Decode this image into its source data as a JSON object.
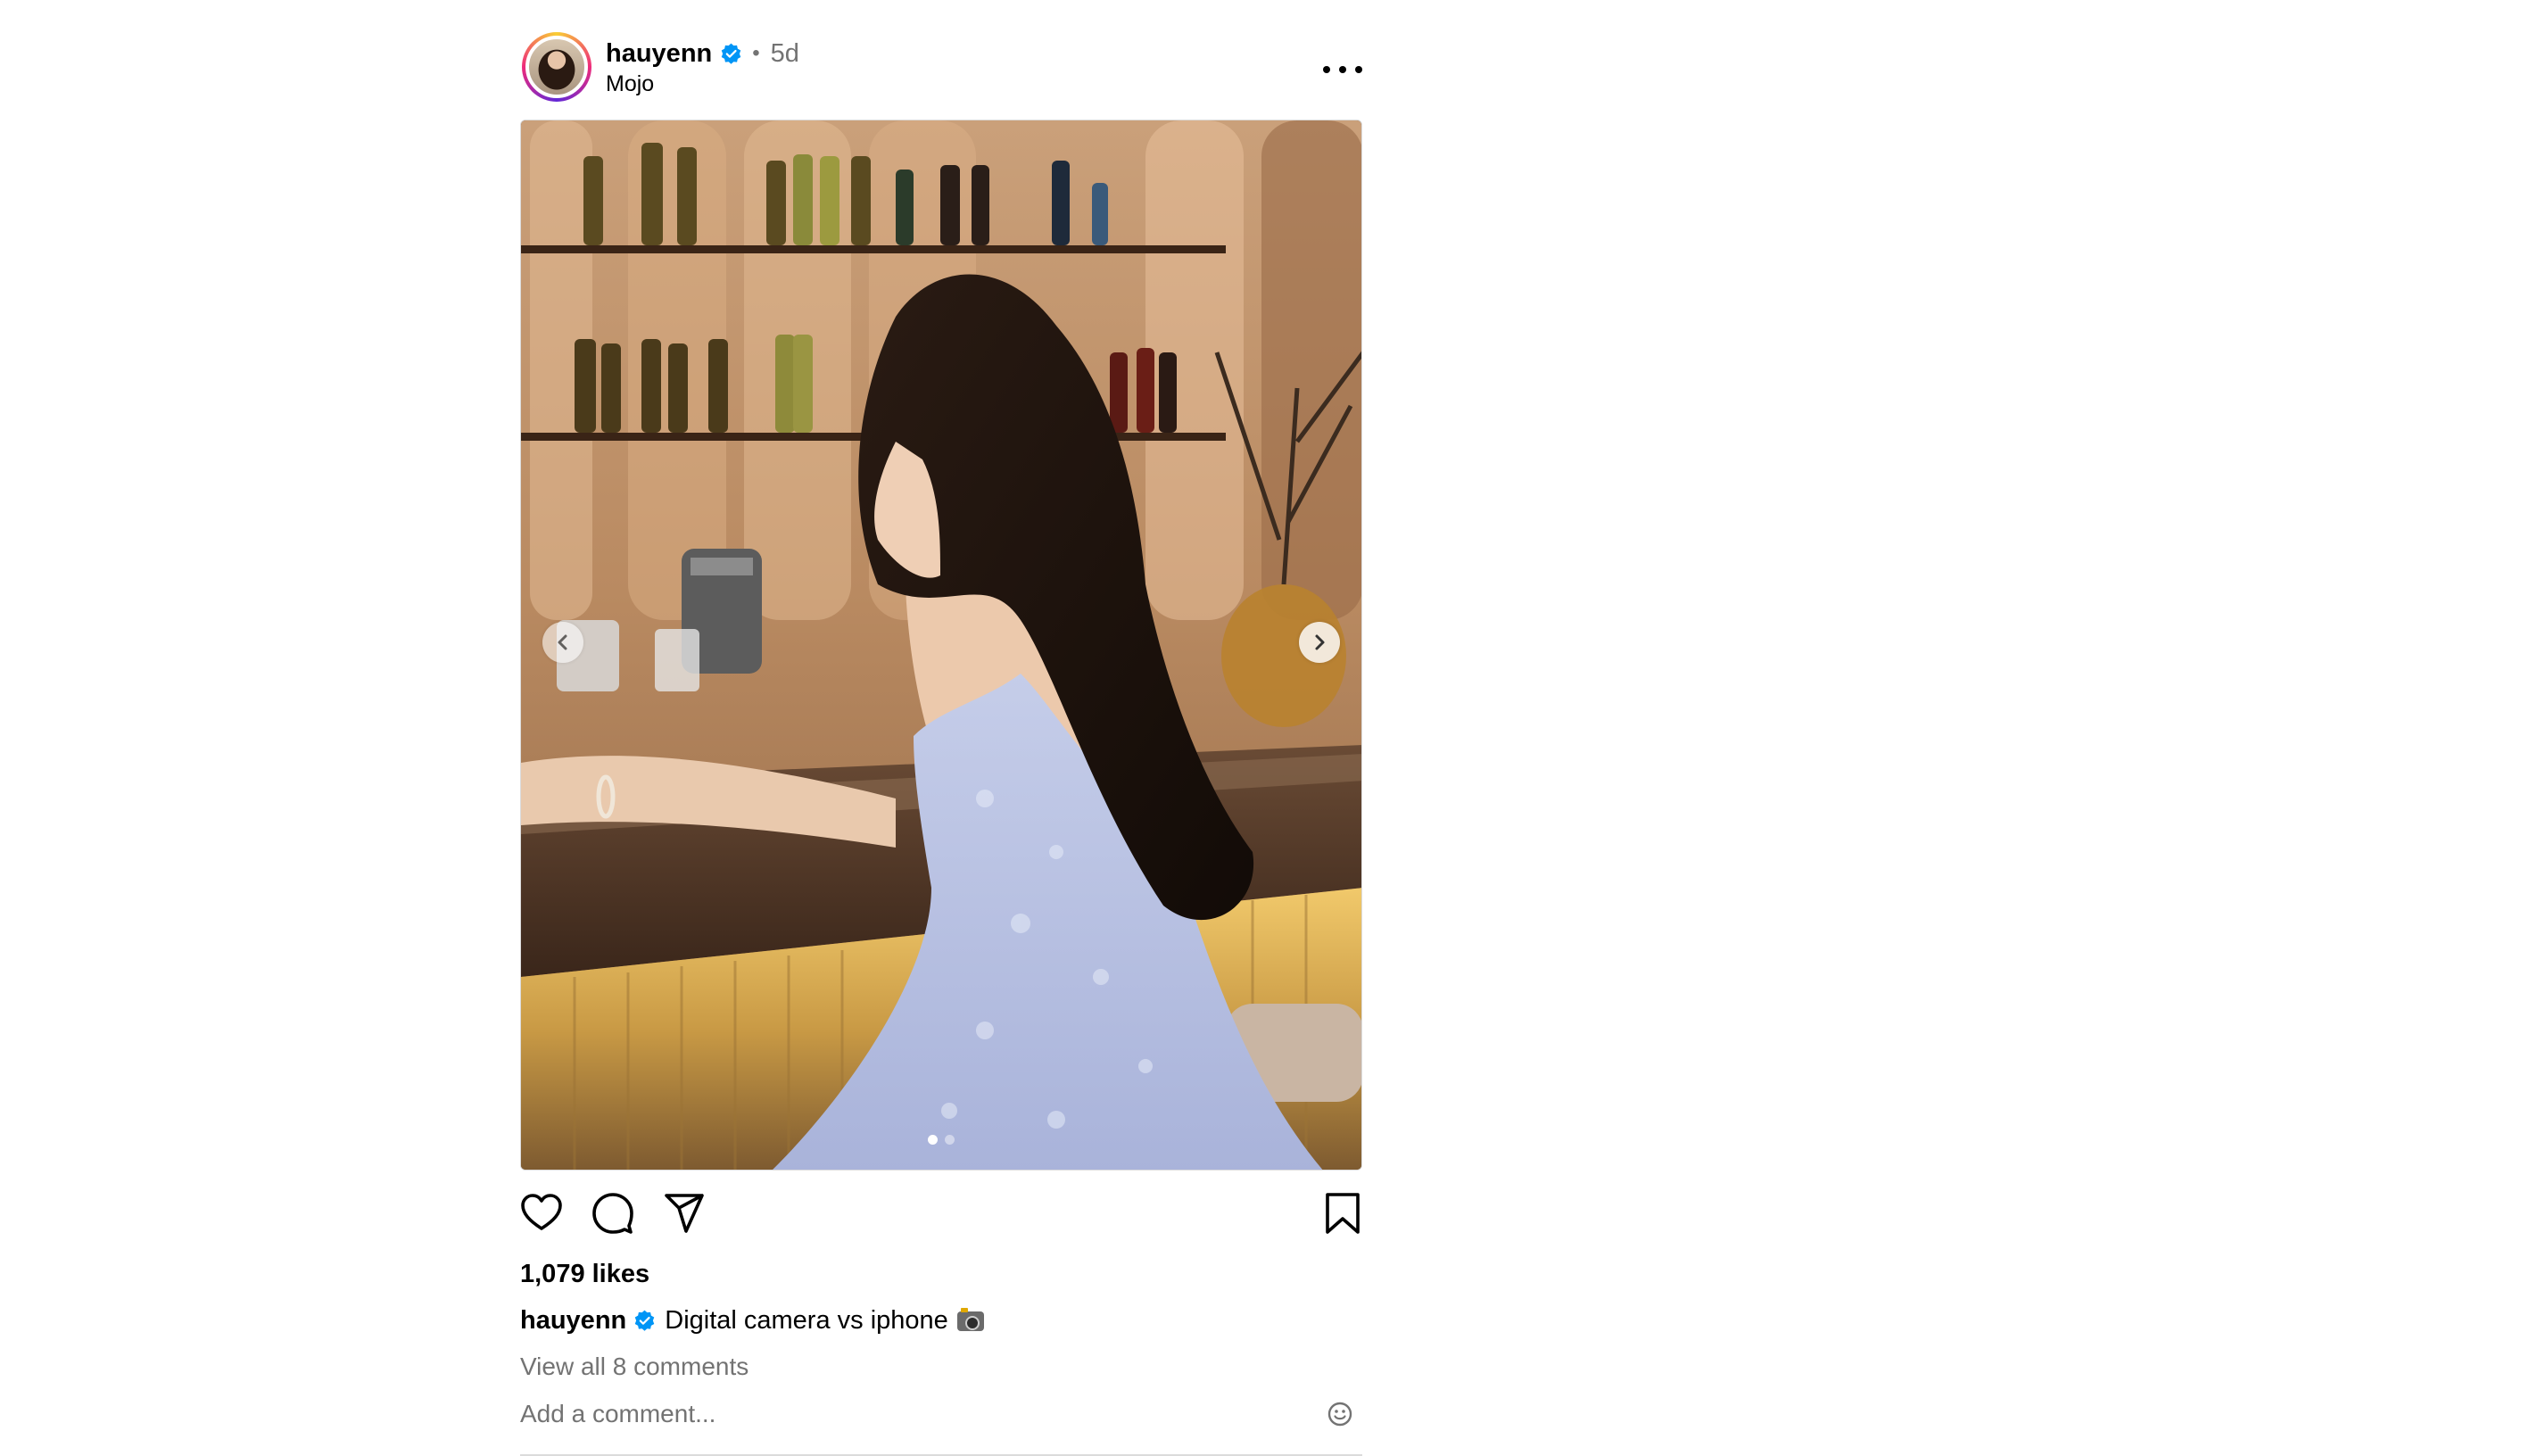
{
  "post": {
    "username": "hauyenn",
    "time_ago": "5d",
    "dot": "•",
    "location": "Mojo",
    "verified_icon": "verified-badge-icon",
    "accent_color": "#0095f6",
    "image_alt": "Woman in a light blue floral dress seated at a bar",
    "carousel": {
      "current": 1,
      "total": 2
    },
    "likes": "1,079 likes",
    "caption_user": "hauyenn",
    "caption_text": "Digital camera vs iphone",
    "caption_emoji": "camera-with-flash-icon",
    "view_comments": "View all 8 comments",
    "comment_placeholder": "Add a comment..."
  },
  "icons": {
    "like": "heart-icon",
    "comment": "comment-bubble-icon",
    "share": "paper-plane-icon",
    "save": "bookmark-icon",
    "more": "more-options-icon",
    "emoji": "smiley-icon",
    "prev": "chevron-left-icon",
    "next": "chevron-right-icon"
  }
}
